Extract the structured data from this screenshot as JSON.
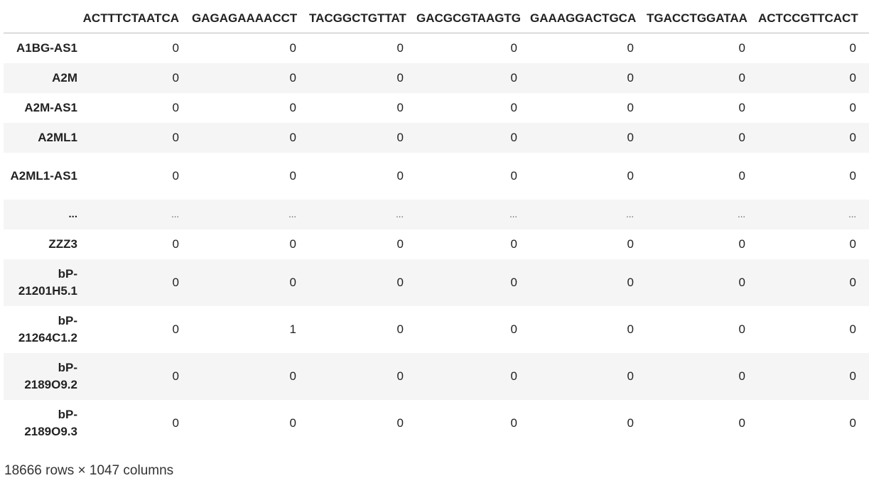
{
  "table": {
    "corner_label": "",
    "columns": [
      "ACTTTCTAATCA",
      "GAGAGAAAACCT",
      "TACGGCTGTTAT",
      "GACGCGTAAGTG",
      "GAAAGGACTGCA",
      "TGACCTGGATAA",
      "ACTCCGTTCACT"
    ],
    "rows": [
      {
        "label": "A1BG-AS1",
        "values": [
          "0",
          "0",
          "0",
          "0",
          "0",
          "0",
          "0"
        ]
      },
      {
        "label": "A2M",
        "values": [
          "0",
          "0",
          "0",
          "0",
          "0",
          "0",
          "0"
        ]
      },
      {
        "label": "A2M-AS1",
        "values": [
          "0",
          "0",
          "0",
          "0",
          "0",
          "0",
          "0"
        ]
      },
      {
        "label": "A2ML1",
        "values": [
          "0",
          "0",
          "0",
          "0",
          "0",
          "0",
          "0"
        ]
      },
      {
        "label": "A2ML1-AS1",
        "values": [
          "0",
          "0",
          "0",
          "0",
          "0",
          "0",
          "0"
        ]
      },
      {
        "label": "...",
        "values": [
          "...",
          "...",
          "...",
          "...",
          "...",
          "...",
          "..."
        ]
      },
      {
        "label": "ZZZ3",
        "values": [
          "0",
          "0",
          "0",
          "0",
          "0",
          "0",
          "0"
        ]
      },
      {
        "label": "bP-21201H5.1",
        "values": [
          "0",
          "0",
          "0",
          "0",
          "0",
          "0",
          "0"
        ]
      },
      {
        "label": "bP-21264C1.2",
        "values": [
          "0",
          "1",
          "0",
          "0",
          "0",
          "0",
          "0"
        ]
      },
      {
        "label": "bP-2189O9.2",
        "values": [
          "0",
          "0",
          "0",
          "0",
          "0",
          "0",
          "0"
        ]
      },
      {
        "label": "bP-2189O9.3",
        "values": [
          "0",
          "0",
          "0",
          "0",
          "0",
          "0",
          "0"
        ]
      }
    ]
  },
  "footer": {
    "shape_text": "18666 rows × 1047 columns"
  }
}
